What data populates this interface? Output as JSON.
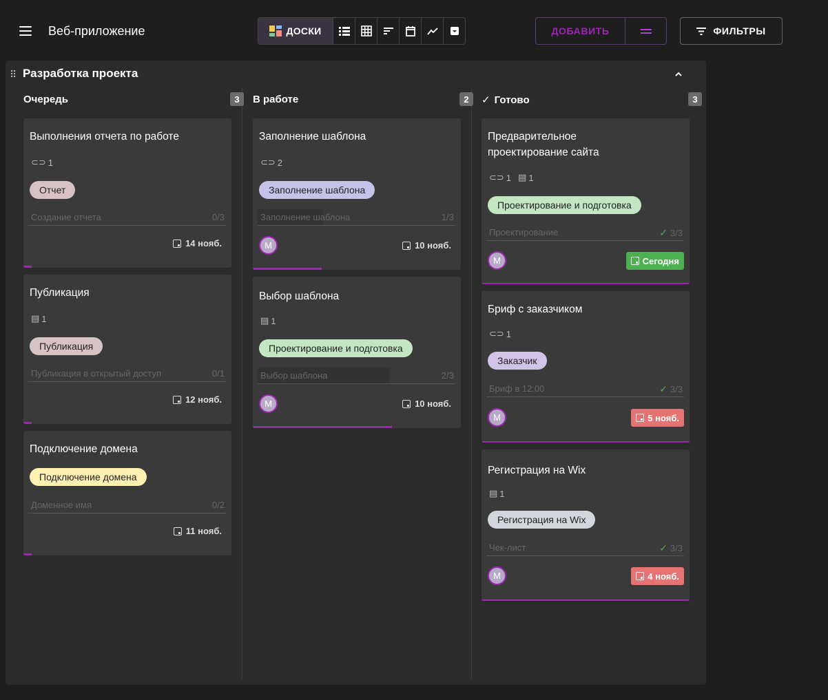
{
  "app": {
    "title": "Веб-приложение"
  },
  "toolbar": {
    "views": [
      {
        "name": "boards",
        "label": "ДОСКИ",
        "icon": "boards-icon",
        "active": true
      },
      {
        "name": "list",
        "icon": "list-icon"
      },
      {
        "name": "table",
        "icon": "table-icon"
      },
      {
        "name": "sort",
        "icon": "sort-icon"
      },
      {
        "name": "calendar",
        "icon": "calendar-icon"
      },
      {
        "name": "chart",
        "icon": "chart-icon"
      },
      {
        "name": "archive",
        "icon": "archive-icon"
      }
    ],
    "add_label": "ДОБАВИТЬ",
    "filters_label": "ФИЛЬТРЫ"
  },
  "colors": {
    "accent": "#9c27b0",
    "done_badge": "#4caf50",
    "overdue_badge": "#e57373"
  },
  "board": {
    "title": "Разработка проекта",
    "columns": [
      {
        "title": "Очередь",
        "count": "3",
        "cards": [
          {
            "title": "Выполнения отчета по работе",
            "attachments": "1",
            "tag": "Отчет",
            "tag_color": "#d7c3c3",
            "checklist_name": "Создание отчета",
            "checklist_count": "0/3",
            "due": "14 нояб.",
            "progress": 0.04
          },
          {
            "title": "Публикация",
            "comments": "1",
            "tag": "Публикация",
            "tag_color": "#d7c3c3",
            "checklist_name": "Публикация в открытый доступ",
            "checklist_count": "0/1",
            "due": "12 нояб.",
            "progress": 0.04
          },
          {
            "title": "Подключение домена",
            "tag": "Подключение домена",
            "tag_color": "#fff0b3",
            "checklist_name": "Доменное имя",
            "checklist_count": "0/2",
            "due": "11 нояб.",
            "progress": 0.04
          }
        ]
      },
      {
        "title": "В работе",
        "count": "2",
        "cards": [
          {
            "title": "Заполнение шаблона",
            "attachments": "2",
            "tag": "Заполнение шаблона",
            "tag_color": "#c5c3e8",
            "checklist_name": "Заполнение шаблона",
            "checklist_count": "1/3",
            "avatar": "M",
            "due": "10 нояб.",
            "progress": 0.33
          },
          {
            "title": "Выбор шаблона",
            "comments": "1",
            "tag": "Проектирование и подготовка",
            "tag_color": "#c3e6c3",
            "checklist_name": "Выбор шаблона",
            "checklist_count": "2/3",
            "avatar": "M",
            "due": "10 нояб.",
            "progress": 0.67
          }
        ]
      },
      {
        "title": "Готово",
        "count": "3",
        "cards": [
          {
            "title_line1": "Предварительное",
            "title_line2": "проектирование сайта",
            "attachments": "1",
            "comments": "1",
            "tag": "Проектирование и подготовка",
            "tag_color": "#c3e6c3",
            "checklist_name": "Проектирование",
            "checklist_count": "3/3",
            "avatar": "M",
            "due": "Сегодня",
            "due_color": "#4caf50"
          },
          {
            "title": "Бриф с заказчиком",
            "attachments": "1",
            "tag": "Заказчик",
            "tag_color": "#d3c3e8",
            "checklist_name": "Бриф в 12:00",
            "checklist_count": "3/3",
            "avatar": "M",
            "due": "5 нояб.",
            "due_color": "#e57373"
          },
          {
            "title": "Регистрация на Wix",
            "comments": "1",
            "tag": "Регистрация на Wix",
            "tag_color": "#d3d6dc",
            "checklist_name": "Чек-лист",
            "checklist_count": "3/3",
            "avatar": "M",
            "due": "4 нояб.",
            "due_color": "#e57373"
          }
        ]
      }
    ]
  }
}
